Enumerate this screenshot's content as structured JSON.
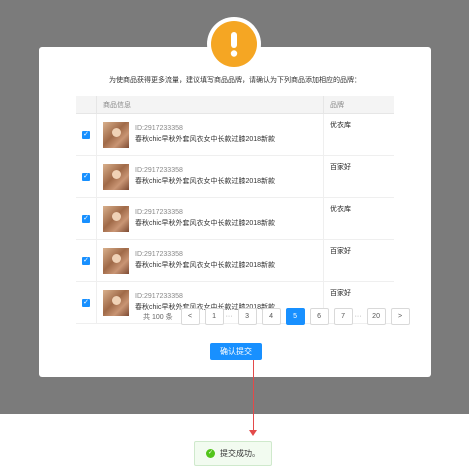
{
  "dialog": {
    "notice": "为使商品获得更多流量，建议填写商品品牌，请确认为下列商品添加相应的品牌：",
    "icon": "warning-icon",
    "accent": "#f5a623"
  },
  "table": {
    "headers": {
      "product": "商品信息",
      "brand": "品牌"
    },
    "rows": [
      {
        "id": "ID:2917233358",
        "name": "春秋chic早秋外套风衣女中长款过膝2018新款",
        "brand": "优衣库",
        "checked": true
      },
      {
        "id": "ID:2917233358",
        "name": "春秋chic早秋外套风衣女中长款过膝2018新款",
        "brand": "百家好",
        "checked": true
      },
      {
        "id": "ID:2917233358",
        "name": "春秋chic早秋外套风衣女中长款过膝2018新款",
        "brand": "优衣库",
        "checked": true
      },
      {
        "id": "ID:2917233358",
        "name": "春秋chic早秋外套风衣女中长款过膝2018新款",
        "brand": "百家好",
        "checked": true
      },
      {
        "id": "ID:2917233358",
        "name": "春秋chic早秋外套风衣女中长款过膝2018新款",
        "brand": "百家好",
        "checked": true
      }
    ]
  },
  "pagination": {
    "total": "共 100 条",
    "prev": "<",
    "next": ">",
    "ellipsis": "···",
    "pages": [
      "1",
      "3",
      "4",
      "5",
      "6",
      "7",
      "20"
    ],
    "current": "5"
  },
  "submit_label": "确认提交",
  "toast": {
    "message": "提交成功。",
    "icon": "check-circle-icon"
  },
  "colors": {
    "primary": "#1890ff",
    "arrow": "#e34a4a",
    "success": "#52c41a"
  }
}
